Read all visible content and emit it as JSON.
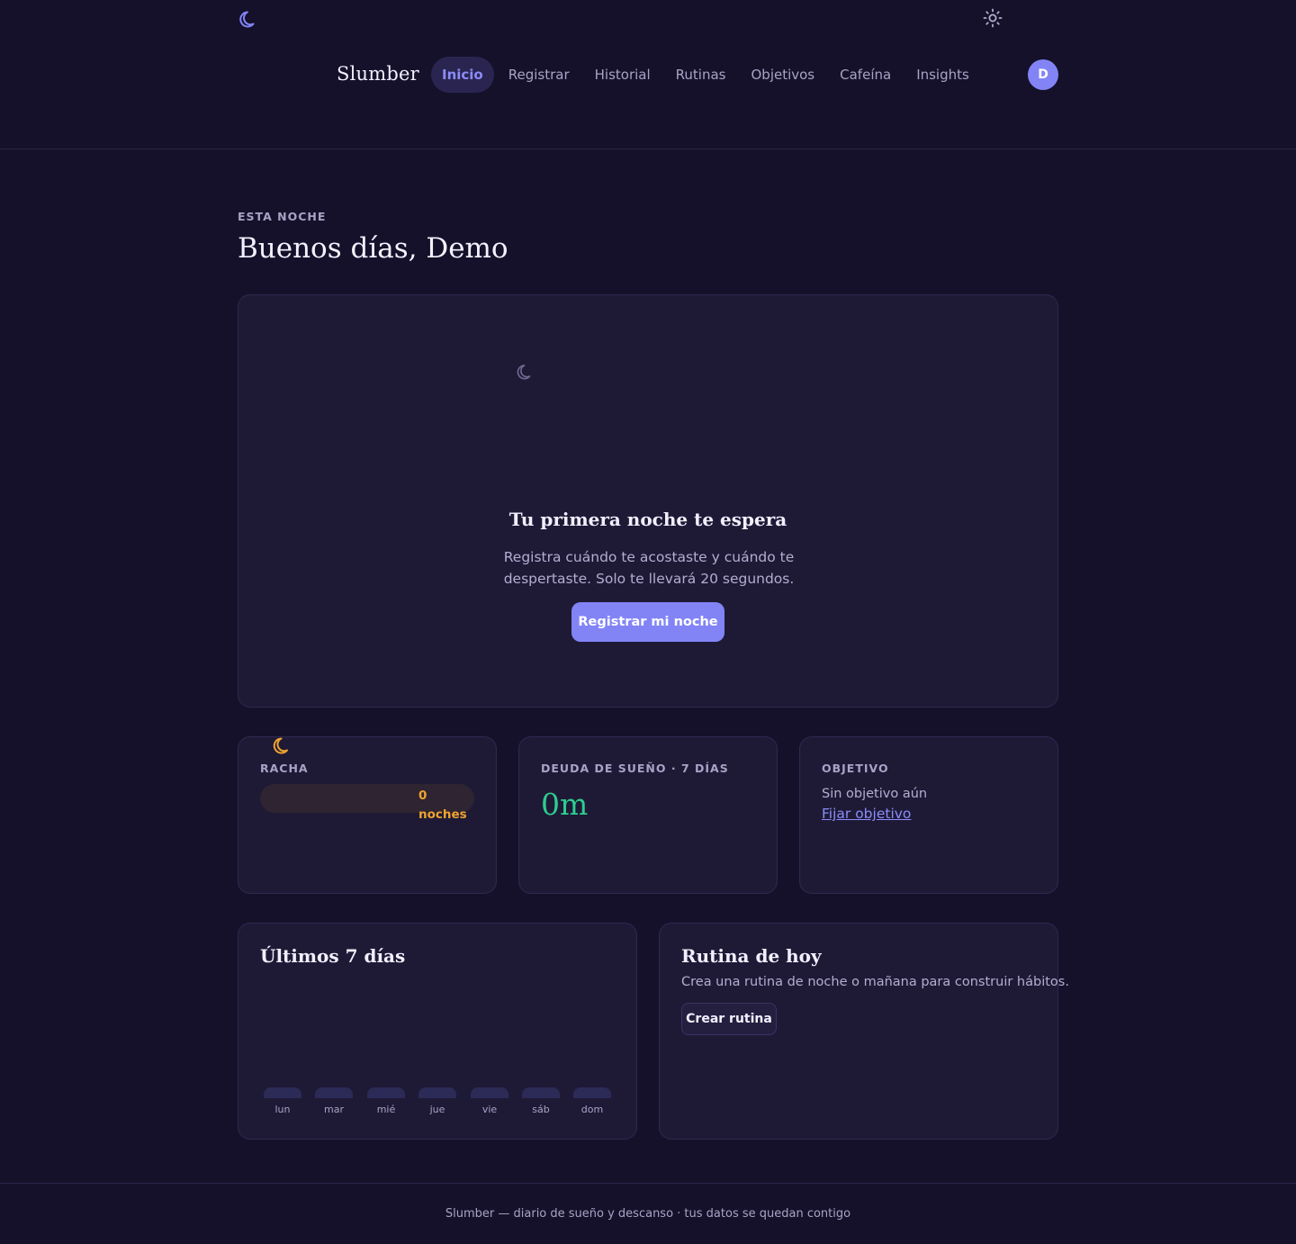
{
  "header": {
    "brand": "Slumber",
    "nav": [
      {
        "label": "Inicio",
        "active": true
      },
      {
        "label": "Registrar"
      },
      {
        "label": "Historial"
      },
      {
        "label": "Rutinas"
      },
      {
        "label": "Objetivos"
      },
      {
        "label": "Cafeína"
      },
      {
        "label": "Insights"
      }
    ],
    "avatar_initial": "D",
    "icons": {
      "logo": "moon-icon",
      "theme": "sun-icon"
    }
  },
  "page": {
    "eyebrow": "ESTA NOCHE",
    "greeting": "Buenos días, Demo"
  },
  "hero": {
    "title": "Tu primera noche te espera",
    "text": "Registra cuándo te acostaste y cuándo te despertaste. Solo te llevará 20 segundos.",
    "button": "Registrar mi noche"
  },
  "stats": {
    "streak": {
      "label": "RACHA",
      "count": "0",
      "unit": "noches"
    },
    "debt": {
      "label": "DEUDA DE SUEÑO · 7 DÍAS",
      "value": "0m"
    },
    "goal": {
      "label": "OBJETIVO",
      "text": "Sin objetivo aún",
      "link": "Fijar objetivo"
    }
  },
  "week": {
    "title": "Últimos 7 días",
    "days": [
      "lun",
      "mar",
      "mié",
      "jue",
      "vie",
      "sáb",
      "dom"
    ]
  },
  "routine": {
    "title": "Rutina de hoy",
    "text": "Crea una rutina de noche o mañana para construir hábitos.",
    "button": "Crear rutina"
  },
  "footer": {
    "text": "Slumber — diario de sueño y descanso · tus datos se quedan contigo"
  },
  "colors": {
    "background": "#15112a",
    "card": "#1e1a36",
    "accent": "#8284f6",
    "streak": "#f0a32e",
    "success": "#2ecc8f"
  }
}
